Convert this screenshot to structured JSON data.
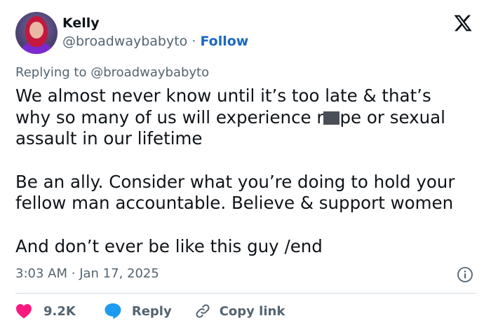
{
  "author": {
    "name": "Kelly",
    "handle": "@broadwaybabyto",
    "separator": "·",
    "follow_label": "Follow"
  },
  "replying_to": {
    "prefix": "Replying to",
    "handle": "@broadwaybabyto"
  },
  "tweet": {
    "line1": "We almost never know until it’s too late & that’s",
    "line2_before": "why so many of us will experience r",
    "line2_after": "pe or sexual",
    "line3": "assault in our lifetime",
    "line4": "Be an ally. Consider what you’re doing to hold your",
    "line5": "fellow man accountable. Believe & support women",
    "line6": "And don’t ever be like this guy /end"
  },
  "timestamp": {
    "time": "3:03 AM",
    "separator": "·",
    "date": "Jan 17, 2025"
  },
  "actions": {
    "likes_count": "9.2K",
    "reply_label": "Reply",
    "copy_link_label": "Copy link"
  },
  "icons": {
    "logo": "x-logo-icon",
    "info": "info-icon",
    "like": "heart-icon",
    "reply": "speech-bubble-icon",
    "copy": "link-icon"
  },
  "colors": {
    "follow": "#1d68c2",
    "heart": "#f91880",
    "reply_bubble": "#1d9bf0",
    "muted_text": "#536471"
  }
}
